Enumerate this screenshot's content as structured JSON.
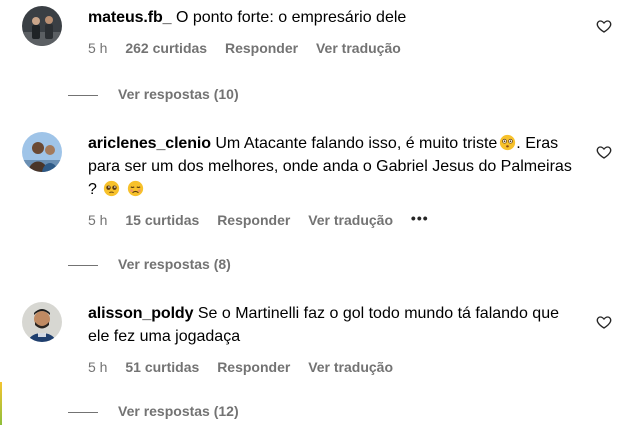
{
  "comments": [
    {
      "username": "mateus.fb_",
      "text": "O ponto forte: o empresário dele",
      "time": "5 h",
      "likes": "262 curtidas",
      "reply_label": "Responder",
      "translate_label": "Ver tradução",
      "view_replies": "Ver respostas (10)",
      "emojis": []
    },
    {
      "username": "ariclenes_clenio",
      "text_part1": "Um Atacante falando isso, é muito triste",
      "text_part2": ". Eras para ser um dos melhores, onde anda o Gabriel Jesus do Palmeiras ?",
      "time": "5 h",
      "likes": "15 curtidas",
      "reply_label": "Responder",
      "translate_label": "Ver tradução",
      "more_label": "•••",
      "view_replies": "Ver respostas (8)",
      "emojis": [
        "flushed-face",
        "pleading-face",
        "disappointed-face"
      ]
    },
    {
      "username": "alisson_poldy",
      "text": "Se o Martinelli faz o gol todo mundo tá falando que ele fez uma jogadaça",
      "time": "5 h",
      "likes": "51 curtidas",
      "reply_label": "Responder",
      "translate_label": "Ver tradução",
      "view_replies": "Ver respostas (12)",
      "emojis": []
    }
  ],
  "colors": {
    "text": "#000000",
    "muted": "#737373",
    "emoji_yellow": "#f7c12b"
  },
  "icons": [
    "heart-outline-icon",
    "more-options-icon"
  ]
}
